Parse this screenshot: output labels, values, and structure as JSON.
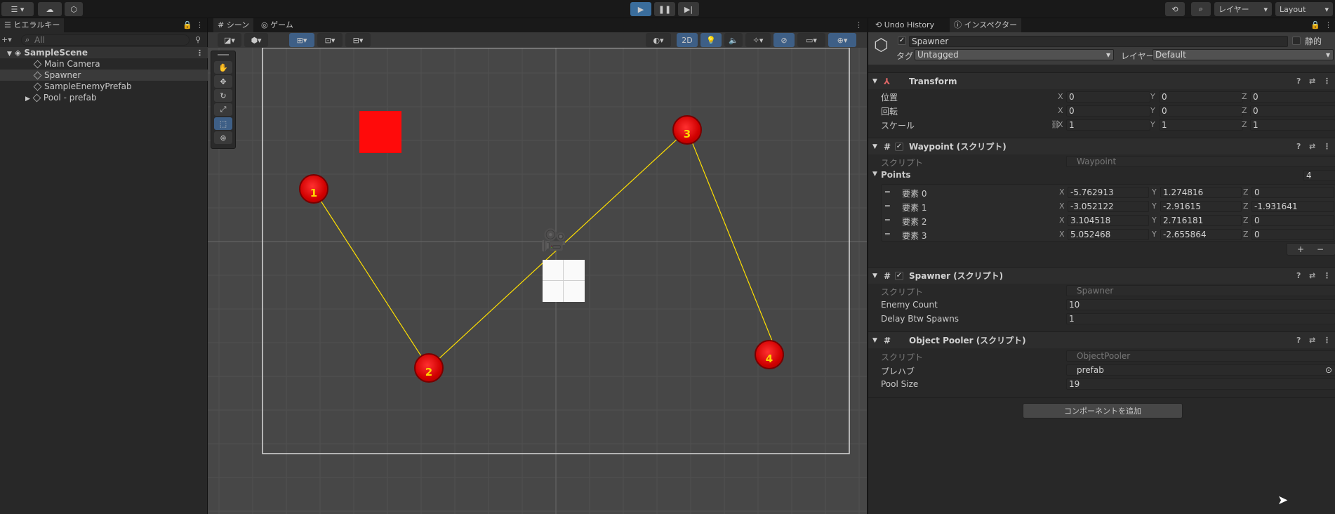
{
  "toolbar": {
    "layers_label": "レイヤー",
    "layout_label": "Layout"
  },
  "hierarchy": {
    "tab_label": "ヒエラルキー",
    "search_placeholder": "All",
    "items": [
      "SampleScene",
      "Main Camera",
      "Spawner",
      "SampleEnemyPrefab",
      "Pool - prefab"
    ]
  },
  "scene": {
    "tab_scene": "シーン",
    "tab_game": "ゲーム",
    "btn_2d": "2D"
  },
  "waypoints": [
    "1",
    "2",
    "3",
    "4"
  ],
  "inspector": {
    "tab_undo": "Undo History",
    "tab_inspector": "インスペクター",
    "object_name": "Spawner",
    "static_label": "静的",
    "tag_label": "タグ",
    "tag_value": "Untagged",
    "layer_label": "レイヤー",
    "layer_value": "Default",
    "transform": {
      "title": "Transform",
      "position_label": "位置",
      "rotation_label": "回転",
      "scale_label": "スケール",
      "position": [
        "0",
        "0",
        "0"
      ],
      "rotation": [
        "0",
        "0",
        "0"
      ],
      "scale": [
        "1",
        "1",
        "1"
      ]
    },
    "axes": [
      "X",
      "Y",
      "Z"
    ],
    "waypoint": {
      "title": "Waypoint (スクリプト)",
      "script_label": "スクリプト",
      "script_value": "Waypoint",
      "points_label": "Points",
      "points_count": "4",
      "elements": [
        {
          "label": "要素 0",
          "x": "-5.762913",
          "y": "1.274816",
          "z": "0"
        },
        {
          "label": "要素 1",
          "x": "-3.052122",
          "y": "-2.91615",
          "z": "-1.931641"
        },
        {
          "label": "要素 2",
          "x": "3.104518",
          "y": "2.716181",
          "z": "0"
        },
        {
          "label": "要素 3",
          "x": "5.052468",
          "y": "-2.655864",
          "z": "0"
        }
      ],
      "add": "+",
      "remove": "−"
    },
    "spawner": {
      "title": "Spawner (スクリプト)",
      "script_label": "スクリプト",
      "script_value": "Spawner",
      "enemy_count_label": "Enemy Count",
      "enemy_count": "10",
      "delay_label": "Delay Btw Spawns",
      "delay": "1"
    },
    "pooler": {
      "title": "Object Pooler (スクリプト)",
      "script_label": "スクリプト",
      "script_value": "ObjectPooler",
      "prefab_label": "プレハブ",
      "prefab_value": "prefab",
      "pool_size_label": "Pool Size",
      "pool_size": "19"
    },
    "add_component": "コンポーネントを追加"
  }
}
